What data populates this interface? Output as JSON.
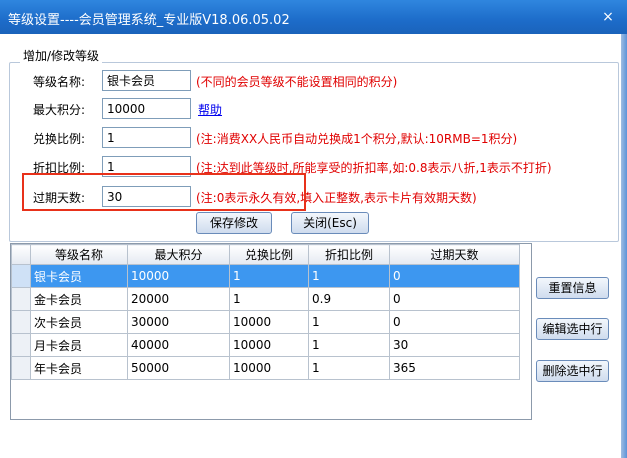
{
  "window": {
    "title": "等级设置----会员管理系统_专业版V18.06.05.02",
    "close_label": "×"
  },
  "group": {
    "legend": "增加/修改等级"
  },
  "form": {
    "name_label": "等级名称:",
    "name_value": "银卡会员",
    "name_note": "(不同的会员等级不能设置相同的积分)",
    "maxpoints_label": "最大积分:",
    "maxpoints_value": "10000",
    "help_link": "帮助",
    "exchange_label": "兑换比例:",
    "exchange_value": "1",
    "exchange_note": "(注:消费XX人民币自动兑换成1个积分,默认:10RMB=1积分)",
    "discount_label": "折扣比例:",
    "discount_value": "1",
    "discount_note": "(注:达到此等级时,所能享受的折扣率,如:0.8表示八折,1表示不打折)",
    "expire_label": "过期天数:",
    "expire_value": "30",
    "expire_note": "(注:0表示永久有效,填入正整数,表示卡片有效期天数)"
  },
  "buttons": {
    "save": "保存修改",
    "close": "关闭(Esc)",
    "reset": "重置信息",
    "edit": "编辑选中行",
    "delete": "删除选中行"
  },
  "table": {
    "columns": [
      "等级名称",
      "最大积分",
      "兑换比例",
      "折扣比例",
      "过期天数"
    ],
    "rows": [
      [
        "银卡会员",
        "10000",
        "1",
        "1",
        "0"
      ],
      [
        "金卡会员",
        "20000",
        "1",
        "0.9",
        "0"
      ],
      [
        "次卡会员",
        "30000",
        "10000",
        "1",
        "0"
      ],
      [
        "月卡会员",
        "40000",
        "10000",
        "1",
        "30"
      ],
      [
        "年卡会员",
        "50000",
        "10000",
        "1",
        "365"
      ]
    ],
    "selected_row": 0
  }
}
